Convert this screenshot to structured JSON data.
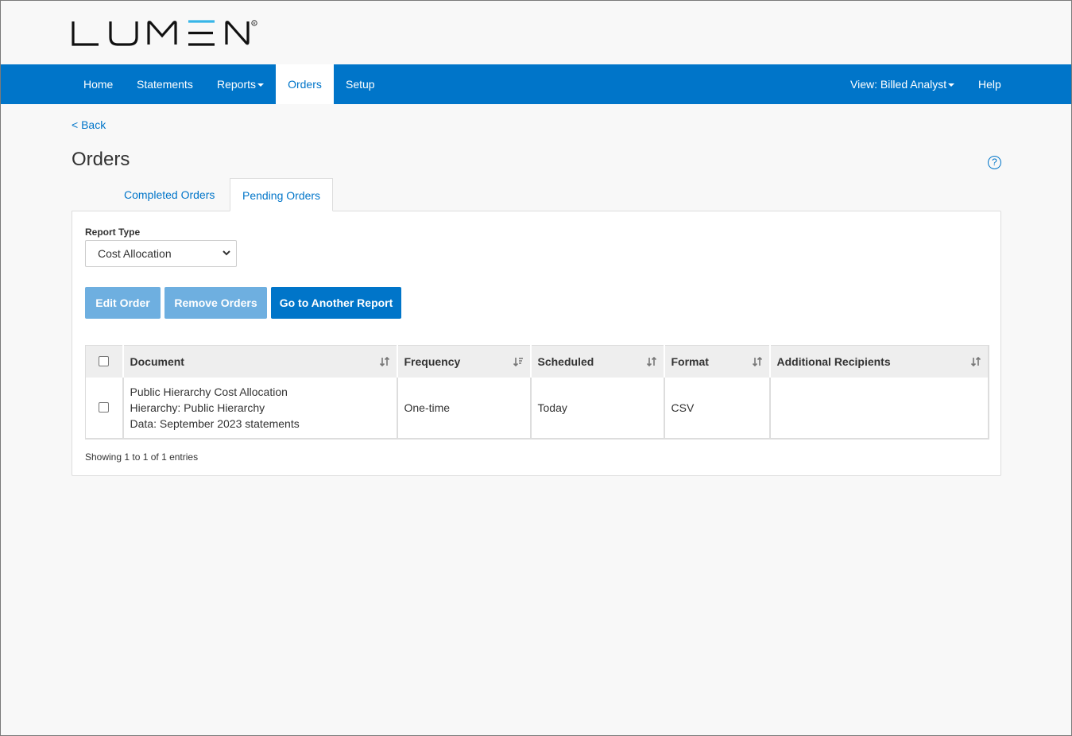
{
  "brand": {
    "logo_text": "LUMEN",
    "accent": "#0075c9",
    "logo_accent": "#38b6e8"
  },
  "nav": {
    "home": "Home",
    "statements": "Statements",
    "reports": "Reports",
    "orders": "Orders",
    "setup": "Setup",
    "view": "View: Billed Analyst",
    "help": "Help"
  },
  "page": {
    "back": "< Back",
    "title": "Orders",
    "help_icon": "?"
  },
  "tabs": {
    "completed": "Completed Orders",
    "pending": "Pending Orders"
  },
  "filters": {
    "report_type_label": "Report Type",
    "report_type_value": "Cost Allocation"
  },
  "buttons": {
    "edit": "Edit Order",
    "remove": "Remove Orders",
    "another": "Go to Another Report"
  },
  "table": {
    "headers": {
      "document": "Document",
      "frequency": "Frequency",
      "scheduled": "Scheduled",
      "format": "Format",
      "recipients": "Additional Recipients"
    },
    "rows": [
      {
        "document_line1": "Public Hierarchy Cost Allocation",
        "document_line2": "Hierarchy: Public Hierarchy",
        "document_line3": "Data: September 2023 statements",
        "frequency": "One-time",
        "scheduled": "Today",
        "format": "CSV",
        "recipients": ""
      }
    ]
  },
  "footer": {
    "entries": "Showing 1 to 1 of 1 entries"
  }
}
